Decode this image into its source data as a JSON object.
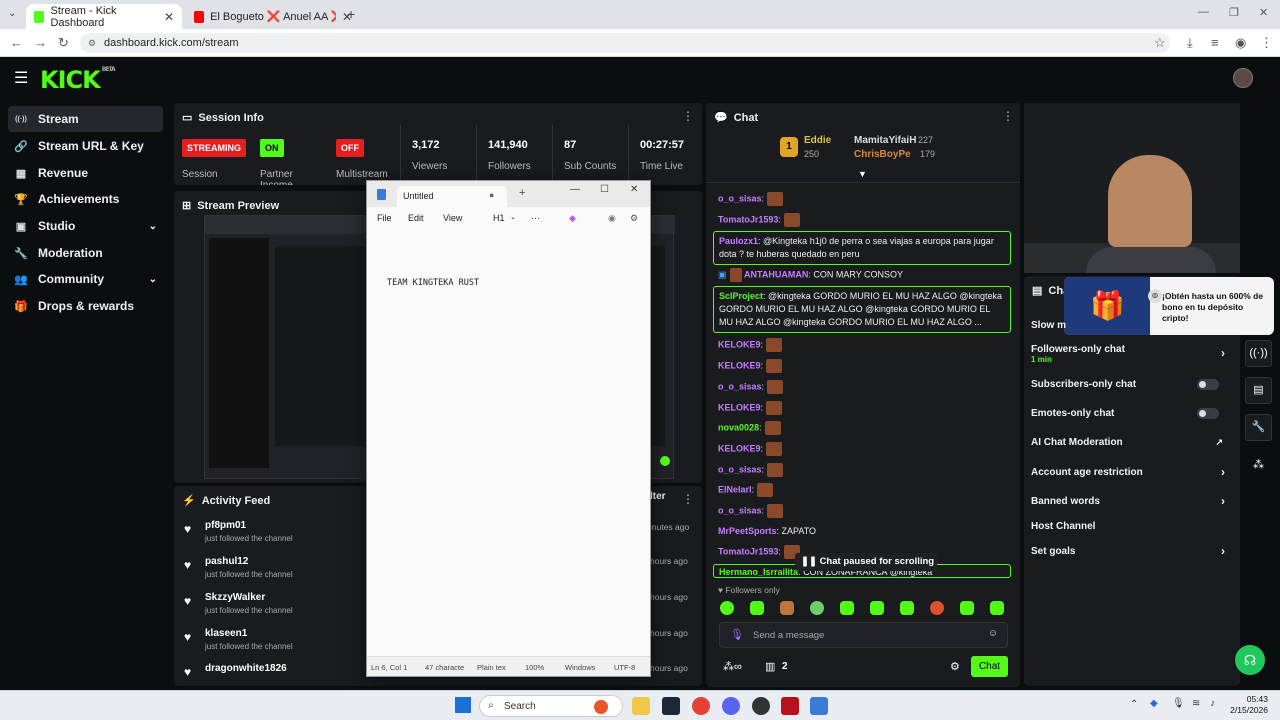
{
  "browser": {
    "tabs": [
      {
        "label": "Stream - Kick Dashboard",
        "active": true
      },
      {
        "label": "El Bogueto ❌ Anuel AA ❌ Yu",
        "active": false
      }
    ],
    "new_tab": "+",
    "url": "dashboard.kick.com/stream"
  },
  "kick": {
    "logo": "KICK",
    "logo_tag": "BETA"
  },
  "sidebar": {
    "items": [
      {
        "label": "Stream",
        "icon": "broadcast-icon",
        "glyph": "((·))"
      },
      {
        "label": "Stream URL & Key",
        "icon": "link-icon",
        "glyph": "🔗"
      },
      {
        "label": "Revenue",
        "icon": "revenue-icon",
        "glyph": "▦"
      },
      {
        "label": "Achievements",
        "icon": "trophy-icon",
        "glyph": "🏆"
      },
      {
        "label": "Studio",
        "icon": "studio-icon",
        "glyph": "▣",
        "chev": "⌄"
      },
      {
        "label": "Moderation",
        "icon": "wrench-icon",
        "glyph": "🔧"
      },
      {
        "label": "Community",
        "icon": "community-icon",
        "glyph": "👥",
        "chev": "⌄"
      },
      {
        "label": "Drops & rewards",
        "icon": "gift-icon",
        "glyph": "🎁"
      }
    ]
  },
  "session": {
    "title": "Session Info",
    "streaming_badge": "STREAMING",
    "session_label": "Session",
    "partner_badge": "ON",
    "partner_label": "Partner Income",
    "multistream_badge": "OFF",
    "multistream_label": "Multistream",
    "viewers": "3,172",
    "viewers_label": "Viewers",
    "followers": "141,940",
    "followers_label": "Followers",
    "subs": "87",
    "subs_label": "Sub Counts",
    "time": "00:27:57",
    "time_label": "Time Live"
  },
  "preview": {
    "title": "Stream Preview"
  },
  "activity": {
    "title": "Activity Feed",
    "items": [
      {
        "name": "pf8pm01",
        "action": "just followed the channel",
        "time": "inutes ago"
      },
      {
        "name": "pashul12",
        "action": "just followed the channel",
        "time": "hours ago"
      },
      {
        "name": "SkzzyWalker",
        "action": "just followed the channel",
        "time": "hours ago"
      },
      {
        "name": "klaseen1",
        "action": "just followed the channel",
        "time": "hours ago"
      },
      {
        "name": "dragonwhite1826",
        "action": "",
        "time": "hours ago"
      }
    ],
    "filter_label": "lter"
  },
  "notepad": {
    "tab_title": "Untitled",
    "menu": [
      "File",
      "Edit",
      "View"
    ],
    "heading_sel": "H1",
    "content": "TEAM KINGTEKA RUST",
    "status": {
      "pos": "Ln 6, Col 1",
      "chars": "47 characte",
      "format": "Plain tex",
      "zoom": "100%",
      "eol": "Windows",
      "enc": "UTF-8"
    }
  },
  "chat": {
    "title": "Chat",
    "leaders": [
      {
        "rank": "1",
        "name": "Eddie",
        "count": "250"
      },
      {
        "name": "MamitaYifaiH",
        "count": "227"
      },
      {
        "name": "ChrisBoyPe",
        "count": "179"
      }
    ],
    "messages": [
      {
        "user": "o_o_sisas",
        "text": "",
        "color": "#c77dff"
      },
      {
        "user": "TomatoJr1593",
        "text": "",
        "color": "#c77dff"
      },
      {
        "user": "Paulozx1",
        "text": "@Kingteka h1j0 de perra o sea viajas a europa para jugar dota ? te huberas quedado en peru",
        "color": "#c77dff"
      },
      {
        "user": "ANTAHUAMAN",
        "text": "CON MARY CONSOY",
        "color": "#c77dff"
      },
      {
        "user": "SclProject",
        "text": "@kingteka GORDO MURIO EL MU HAZ ALGO @kingteka GORDO MURIO EL MU HAZ ALGO @kingteka GORDO MURIO EL MU HAZ ALGO @kingteka GORDO MURIO EL MU HAZ ALGO ...",
        "color": "#53fc18"
      },
      {
        "user": "KELOKE9",
        "text": "",
        "color": "#c77dff"
      },
      {
        "user": "KELOKE9",
        "text": "",
        "color": "#c77dff"
      },
      {
        "user": "o_o_sisas",
        "text": "",
        "color": "#c77dff"
      },
      {
        "user": "KELOKE9",
        "text": "",
        "color": "#c77dff"
      },
      {
        "user": "nova0028",
        "text": "",
        "color": "#53fc18"
      },
      {
        "user": "KELOKE9",
        "text": "",
        "color": "#c77dff"
      },
      {
        "user": "o_o_sisas",
        "text": "",
        "color": "#c77dff"
      },
      {
        "user": "ElNelarl",
        "text": "",
        "color": "#c77dff"
      },
      {
        "user": "o_o_sisas",
        "text": "",
        "color": "#c77dff"
      },
      {
        "user": "MrPeetSports",
        "text": "ZAPATO",
        "color": "#c77dff"
      },
      {
        "user": "TomatoJr1593",
        "text": "",
        "color": "#c77dff"
      },
      {
        "user": "Hermano_Isrrailita",
        "text": "CON ZONAFRANCA @kingteka",
        "color": "#53fc18"
      }
    ],
    "paused": "Chat paused for scrolling",
    "followers_only": "Followers only",
    "input_placeholder": "Send a message",
    "viewer_count": "2",
    "send_label": "Chat"
  },
  "chat_settings": {
    "title": "Cha",
    "slow": "Slow m",
    "rows": [
      {
        "label": "Followers-only chat",
        "sub": "1 min",
        "ctrl": "chevron"
      },
      {
        "label": "Subscribers-only chat",
        "ctrl": "toggle"
      },
      {
        "label": "Emotes-only chat",
        "ctrl": "toggle"
      },
      {
        "label": "AI Chat Moderation",
        "ctrl": "external"
      },
      {
        "label": "Account age restriction",
        "ctrl": "chevron"
      },
      {
        "label": "Banned words",
        "ctrl": "chevron"
      },
      {
        "label": "Host Channel",
        "ctrl": "none"
      },
      {
        "label": "Set goals",
        "ctrl": "chevron"
      }
    ],
    "promo": "¡Obtén hasta un 600% de bono en tu depósito cripto!"
  },
  "taskbar": {
    "search": "Search",
    "time": "05:43",
    "date": "2/15/2026"
  },
  "colors": {
    "accent": "#53fc18",
    "panel": "#191b1f",
    "bg": "#0b0e0f",
    "live_red": "#e51f1f"
  }
}
